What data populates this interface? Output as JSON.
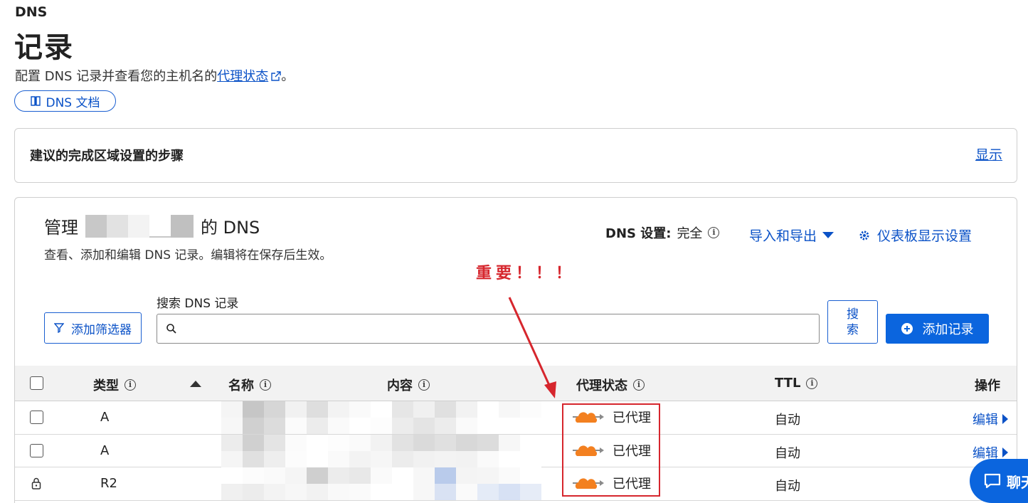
{
  "header": {
    "breadcrumb": "DNS",
    "title": "记录",
    "description_prefix": "配置 DNS 记录并查看您的主机名的",
    "description_link": "代理状态",
    "description_suffix": "。",
    "docs_button": "DNS 文档"
  },
  "steps_card": {
    "title": "建议的完成区域设置的步骤",
    "show_link": "显示"
  },
  "manage": {
    "title_prefix": "管理",
    "title_suffix": "的 DNS",
    "subtitle": "查看、添加和编辑 DNS 记录。编辑将在保存后生效。",
    "dns_setting_label": "DNS 设置:",
    "dns_setting_value": "完全",
    "import_export": "导入和导出",
    "dashboard_settings": "仪表板显示设置"
  },
  "annotation": "重要！！！",
  "search": {
    "filter_button": "添加筛选器",
    "label": "搜索 DNS 记录",
    "placeholder": "",
    "search_button_line1": "搜",
    "search_button_line2": "索",
    "add_record_button": "添加记录"
  },
  "table": {
    "columns": {
      "type": "类型",
      "name": "名称",
      "content": "内容",
      "proxy": "代理状态",
      "ttl": "TTL",
      "actions": "操作"
    },
    "rows": [
      {
        "type": "A",
        "proxy": "已代理",
        "ttl": "自动",
        "action": "编辑",
        "locked": false
      },
      {
        "type": "A",
        "proxy": "已代理",
        "ttl": "自动",
        "action": "编辑",
        "locked": false
      },
      {
        "type": "R2",
        "proxy": "已代理",
        "ttl": "自动",
        "action": "",
        "locked": true
      }
    ]
  },
  "chat_button": "聊天",
  "colors": {
    "accent": "#0b65de",
    "link": "#0b52c7",
    "annotation_red": "#d6262d",
    "cloud_orange": "#f38020"
  }
}
